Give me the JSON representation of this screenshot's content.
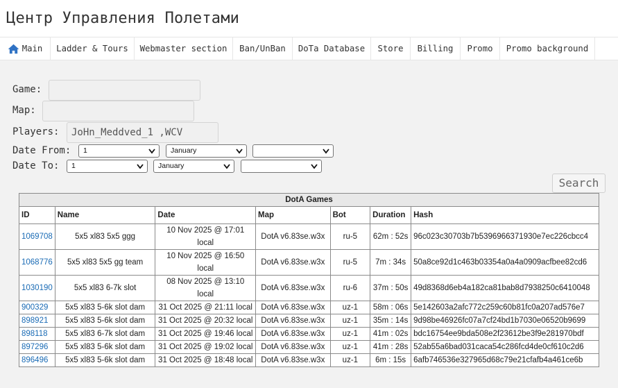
{
  "header": {
    "title": "Центр Управления Полетами"
  },
  "nav": {
    "items": [
      {
        "label": "Main",
        "icon": "home-icon"
      },
      {
        "label": "Ladder & Tours"
      },
      {
        "label": "Webmaster section"
      },
      {
        "label": "Ban/UnBan"
      },
      {
        "label": "DoTa Database"
      },
      {
        "label": "Store"
      },
      {
        "label": "Billing"
      },
      {
        "label": "Promo"
      },
      {
        "label": "Promo background"
      }
    ]
  },
  "form": {
    "game_label": "Game:",
    "game_value": "",
    "map_label": "Map:",
    "map_value": "",
    "players_label": "Players:",
    "players_value": "JoHn_Meddved_1 ,WCV",
    "date_from_label": "Date From:",
    "date_from": {
      "day": "1",
      "month": "January",
      "year": ""
    },
    "date_to_label": "Date To:",
    "date_to": {
      "day": "1",
      "month": "January",
      "year": ""
    },
    "search_label": "Search"
  },
  "table": {
    "caption": "DotA Games",
    "headers": [
      "ID",
      "Name",
      "Date",
      "Map",
      "Bot",
      "Duration",
      "Hash"
    ],
    "rows": [
      {
        "id": "1069708",
        "name": "5x5 xl83 5x5 ggg",
        "date": "10 Nov 2025 @ 17:01 local",
        "map": "DotA v6.83se.w3x",
        "bot": "ru-5",
        "duration": "62m : 52s",
        "hash": "96c023c30703b7b5396966371930e7ec226cbcc4"
      },
      {
        "id": "1068776",
        "name": "5x5 xl83 5x5 gg team",
        "date": "10 Nov 2025 @ 16:50 local",
        "map": "DotA v6.83se.w3x",
        "bot": "ru-5",
        "duration": "7m : 34s",
        "hash": "50a8ce92d1c463b03354a0a4a0909acfbee82cd6"
      },
      {
        "id": "1030190",
        "name": "5x5 xl83 6-7k slot",
        "date": "08 Nov 2025 @ 13:10 local",
        "map": "DotA v6.83se.w3x",
        "bot": "ru-6",
        "duration": "37m : 50s",
        "hash": "49d8368d6eb4a182ca81bab8d7938250c6410048"
      },
      {
        "id": "900329",
        "name": "5x5 xl83 5-6k slot dam",
        "date": "31 Oct 2025 @ 21:11 local",
        "map": "DotA v6.83se.w3x",
        "bot": "uz-1",
        "duration": "58m : 06s",
        "hash": "5e142603a2afc772c259c60b81fc0a207ad576e7"
      },
      {
        "id": "898921",
        "name": "5x5 xl83 5-6k slot dam",
        "date": "31 Oct 2025 @ 20:32 local",
        "map": "DotA v6.83se.w3x",
        "bot": "uz-1",
        "duration": "35m : 14s",
        "hash": "9d98be46926fc07a7cf24bd1b7030e06520b9699"
      },
      {
        "id": "898118",
        "name": "5x5 xl83 6-7k slot dam",
        "date": "31 Oct 2025 @ 19:46 local",
        "map": "DotA v6.83se.w3x",
        "bot": "uz-1",
        "duration": "41m : 02s",
        "hash": "bdc16754ee9bda508e2f23612be3f9e281970bdf"
      },
      {
        "id": "897296",
        "name": "5x5 xl83 5-6k slot dam",
        "date": "31 Oct 2025 @ 19:02 local",
        "map": "DotA v6.83se.w3x",
        "bot": "uz-1",
        "duration": "41m : 28s",
        "hash": "52ab55a6bad031caca54c286fcd4de0cf610c2d6"
      },
      {
        "id": "896496",
        "name": "5x5 xl83 5-6k slot dam",
        "date": "31 Oct 2025 @ 18:48 local",
        "map": "DotA v6.83se.w3x",
        "bot": "uz-1",
        "duration": "6m : 15s",
        "hash": "6afb746536e327965d68c79e21cfafb4a461ce6b"
      }
    ]
  },
  "colors": {
    "link": "#1a6bb5",
    "home_icon": "#2f72c4",
    "page_bg": "#f2f2f2"
  }
}
